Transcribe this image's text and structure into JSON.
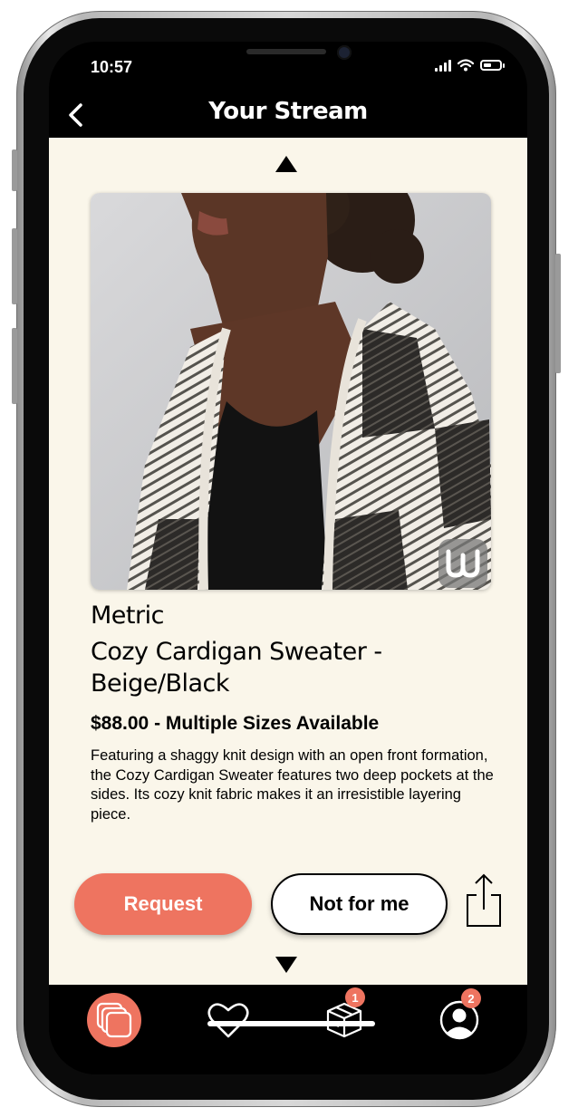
{
  "status_bar": {
    "time": "10:57"
  },
  "header": {
    "title": "Your Stream",
    "back_icon": "chevron-left-icon"
  },
  "product": {
    "brand": "Metric",
    "name": "Cozy Cardigan Sweater - Beige/Black",
    "price_line": "$88.00 - Multiple Sizes Available",
    "description": "Featuring a shaggy knit design with an open front formation, the Cozy Cardigan Sweater features two deep pockets at the sides. Its cozy knit fabric makes it an irresistible layering piece."
  },
  "actions": {
    "request_label": "Request",
    "not_for_me_label": "Not for me",
    "share_icon": "share-icon"
  },
  "tabbar": {
    "tabs": [
      {
        "icon": "stream-cards-icon",
        "active": true
      },
      {
        "icon": "heart-icon",
        "active": false
      },
      {
        "icon": "package-icon",
        "badge": "1",
        "active": false
      },
      {
        "icon": "profile-icon",
        "badge": "2",
        "active": false
      }
    ]
  },
  "colors": {
    "accent": "#ee7460",
    "background": "#faf6ea",
    "bar": "#000000"
  }
}
